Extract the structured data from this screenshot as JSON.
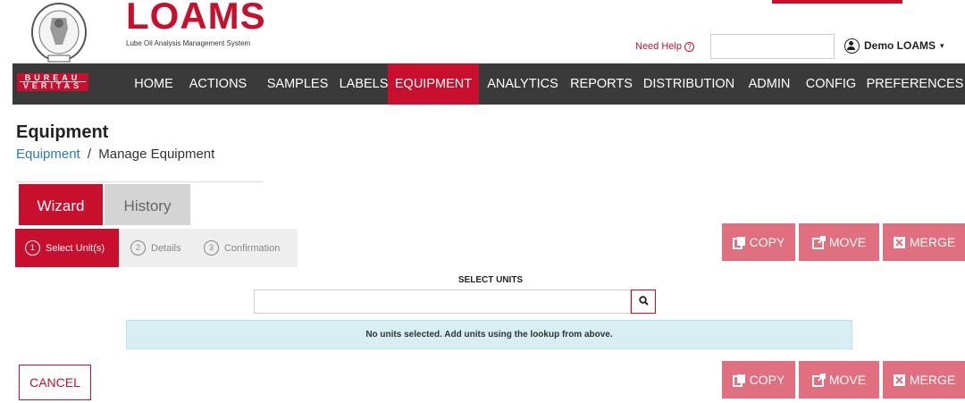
{
  "header": {
    "seal_text": "BUREAU VERITAS 1828",
    "logo_word": "LOAMS",
    "logo_tagline": "Lube Oil Analysis Management System",
    "need_help": "Need Help",
    "help_icon": "question-circle-icon",
    "search_value": "",
    "user_name": "Demo LOAMS",
    "user_icon": "user-circle-icon",
    "brand_color": "#c8102e"
  },
  "badge": {
    "line1": "BUREAU",
    "line2": "VERITAS"
  },
  "nav": {
    "items": [
      {
        "label": "HOME"
      },
      {
        "label": "ACTIONS"
      },
      {
        "label": "SAMPLES"
      },
      {
        "label": "LABELS"
      },
      {
        "label": "EQUIPMENT",
        "active": true
      },
      {
        "label": "ANALYTICS"
      },
      {
        "label": "REPORTS"
      },
      {
        "label": "DISTRIBUTION"
      },
      {
        "label": "ADMIN"
      },
      {
        "label": "CONFIG"
      },
      {
        "label": "PREFERENCES"
      }
    ]
  },
  "page": {
    "title": "Equipment",
    "breadcrumb_link": "Equipment",
    "breadcrumb_sep": "/",
    "breadcrumb_current": "Manage Equipment"
  },
  "tabs": {
    "wizard": "Wizard",
    "history": "History"
  },
  "steps": [
    {
      "num": "1",
      "label": "Select Unit(s)"
    },
    {
      "num": "2",
      "label": "Details"
    },
    {
      "num": "3",
      "label": "Confirmation"
    }
  ],
  "actions": {
    "copy": "COPY",
    "move": "MOVE",
    "merge": "MERGE",
    "copy_icon": "copy-icon",
    "move_icon": "external-link-icon",
    "merge_icon": "merge-icon"
  },
  "select_units": {
    "label": "SELECT UNITS",
    "value": "",
    "search_icon": "search-icon",
    "empty_message": "No units selected. Add units using the lookup from above."
  },
  "cancel": "CANCEL"
}
